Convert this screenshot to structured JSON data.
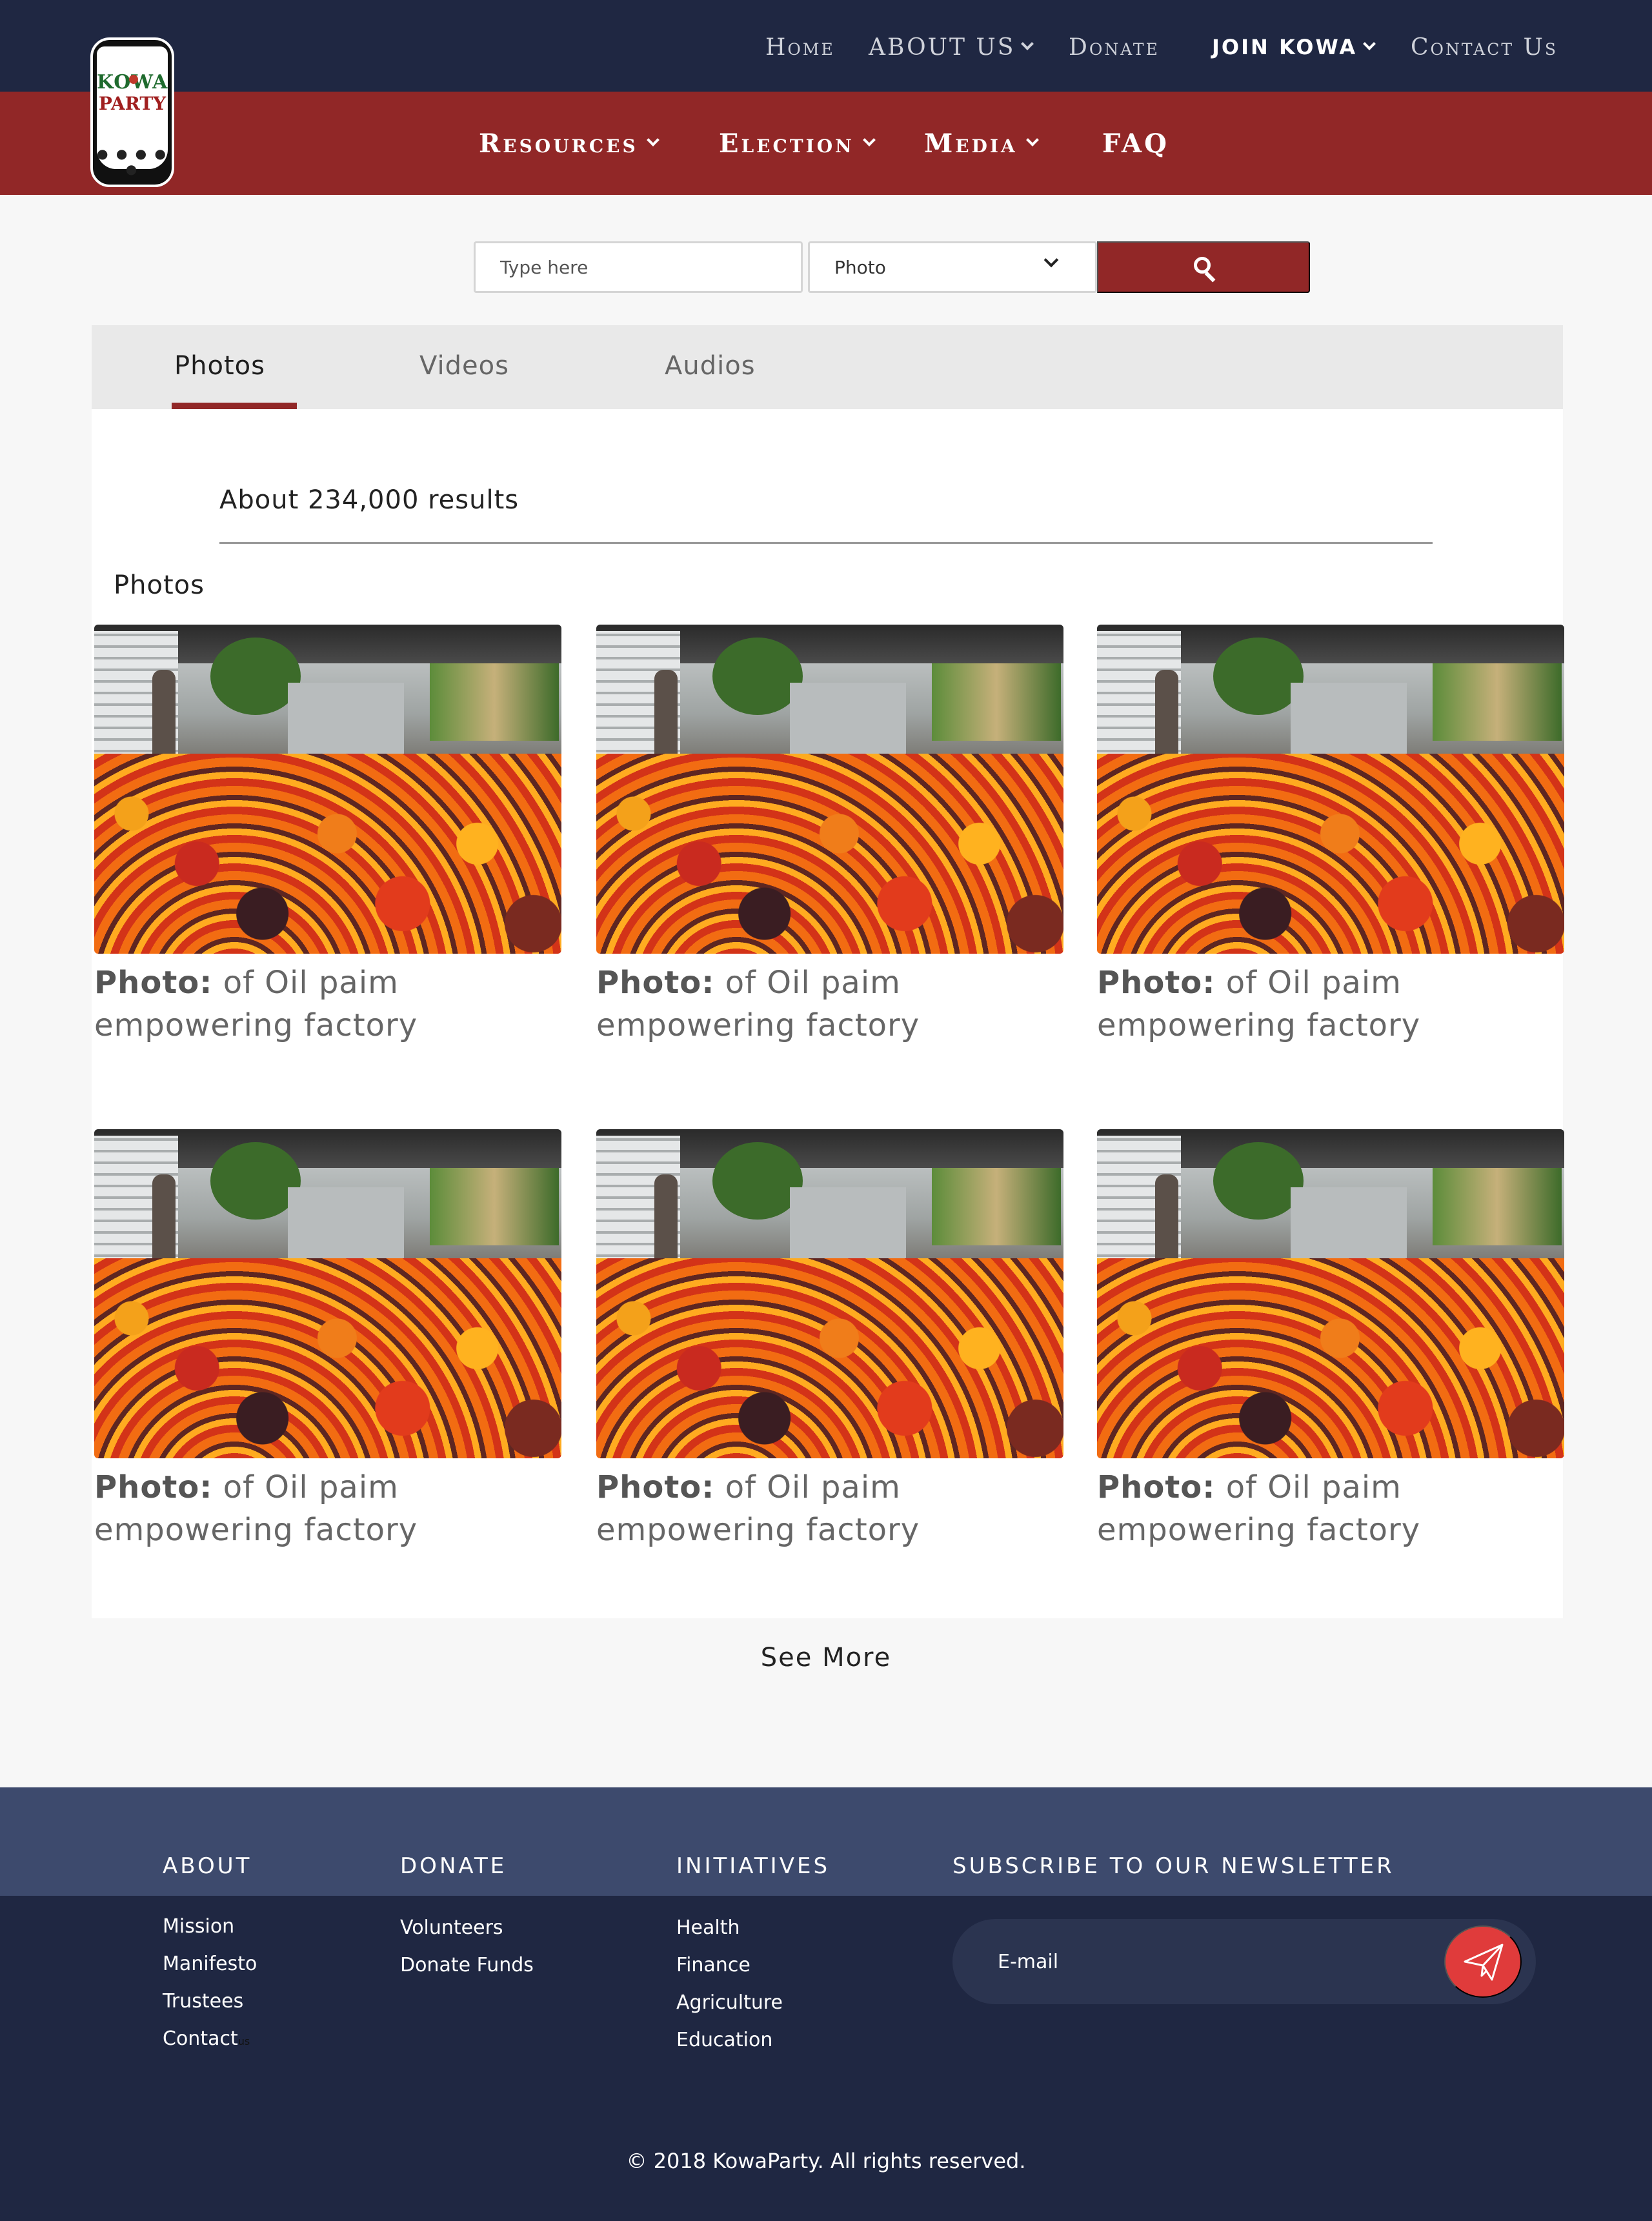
{
  "brand": {
    "logo_line1": "KOWA",
    "logo_line2": "PARTY"
  },
  "top_nav": {
    "home": "Home",
    "about_us": "ABOUT US",
    "donate": "Donate",
    "join_kowa": "JOIN KOWA",
    "contact_us": "Contact Us"
  },
  "main_nav": {
    "resources": "Resources",
    "election": "Election",
    "media": "Media",
    "faq": "FAQ"
  },
  "search": {
    "placeholder": "Type here",
    "type_selected": "Photo"
  },
  "tabs": [
    "Photos",
    "Videos",
    "Audios"
  ],
  "active_tab": "Photos",
  "results": {
    "count_text": "About 234,000 results",
    "section_heading": "Photos",
    "items": [
      {
        "label": "Photo:",
        "title_line1": "of Oil paim",
        "title_line2": "empowering factory"
      },
      {
        "label": "Photo:",
        "title_line1": "of Oil paim",
        "title_line2": "empowering factory"
      },
      {
        "label": "Photo:",
        "title_line1": "of Oil paim",
        "title_line2": "empowering factory"
      },
      {
        "label": "Photo:",
        "title_line1": "of Oil paim",
        "title_line2": "empowering factory"
      },
      {
        "label": "Photo:",
        "title_line1": "of Oil paim",
        "title_line2": "empowering factory"
      },
      {
        "label": "Photo:",
        "title_line1": "of Oil paim",
        "title_line2": "empowering factory"
      }
    ],
    "see_more": "See More"
  },
  "footer": {
    "about": {
      "title": "ABOUT",
      "links": [
        "Mission",
        "Manifesto",
        "Trustees",
        "Contact"
      ],
      "contact_suffix": "us"
    },
    "donate": {
      "title": "DONATE",
      "links": [
        "Volunteers",
        "Donate Funds"
      ]
    },
    "initiatives": {
      "title": "INITIATIVES",
      "links": [
        "Health",
        "Finance",
        "Agriculture",
        "Education"
      ]
    },
    "newsletter": {
      "title": "SUBSCRIBE TO OUR NEWSLETTER",
      "placeholder": "E-mail"
    },
    "copyright": "© 2018 KowaParty. All rights reserved."
  },
  "colors": {
    "navy": "#1f2742",
    "brand_red": "#912727",
    "footer_top": "#3d4a6d",
    "send_button": "#e03b3b"
  },
  "icons": [
    "chevron-down-icon",
    "search-icon",
    "send-icon"
  ]
}
